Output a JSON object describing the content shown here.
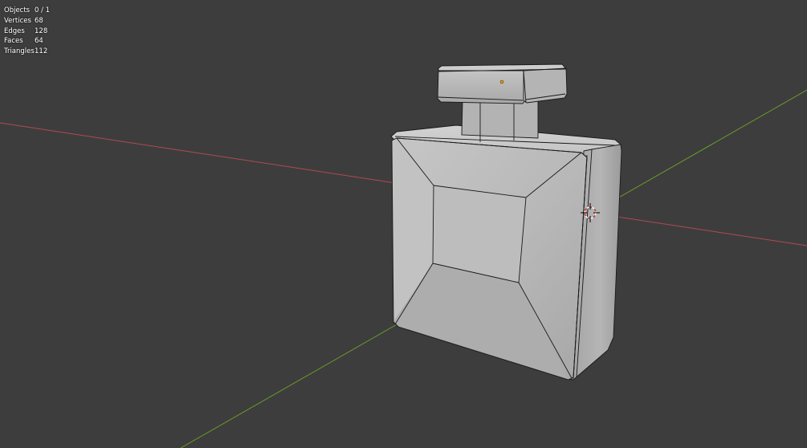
{
  "stats": {
    "objects_label": "Objects",
    "objects_value": "0 / 1",
    "vertices_label": "Vertices",
    "vertices_value": "68",
    "edges_label": "Edges",
    "edges_value": "128",
    "faces_label": "Faces",
    "faces_value": "64",
    "triangles_label": "Triangles",
    "triangles_value": "112"
  },
  "colors": {
    "background": "#3d3d3d",
    "x_axis": "#b04a54",
    "y_axis": "#6a9a2a",
    "mesh_surface": "#b6b6b6",
    "wire": "#1a1a1a",
    "origin_dot": "#e8a010",
    "cursor_red": "#d03030",
    "cursor_white": "#ffffff"
  },
  "scene": {
    "object": "perfume-bottle-mesh",
    "origin_icon": "object-origin-dot",
    "cursor_icon": "3d-cursor-icon"
  }
}
